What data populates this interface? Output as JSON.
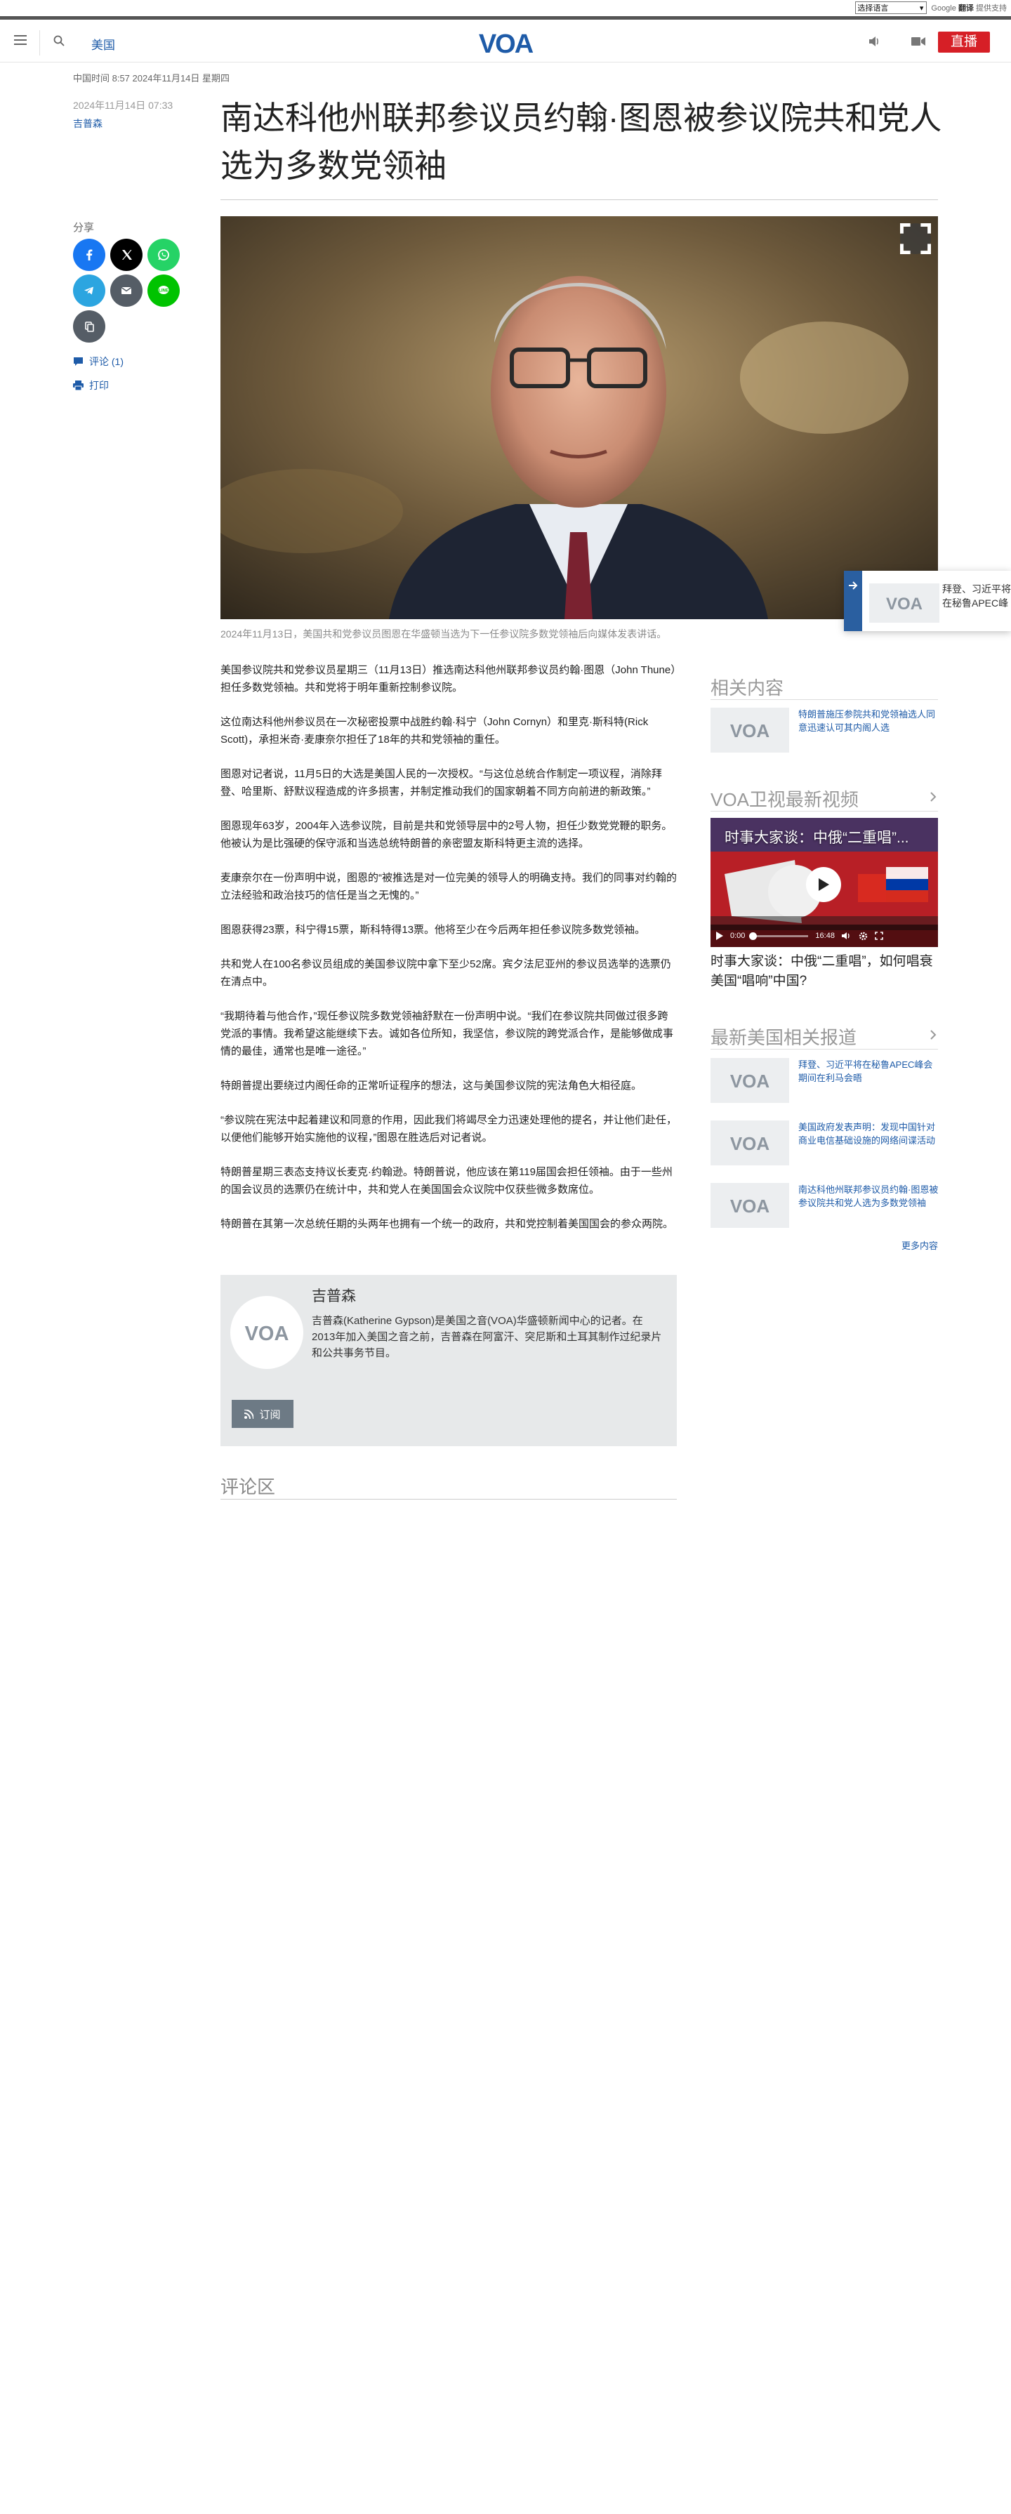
{
  "translate": {
    "select_label": "选择语言",
    "google": "Google",
    "translate": "翻译",
    "powered": "提供支持"
  },
  "header": {
    "section": "美国",
    "live": "直播",
    "logo_text": "VOA"
  },
  "meta": {
    "date_line": "中国时间 8:57 2024年11月14日 星期四",
    "pub_date": "2024年11月14日 07:33",
    "author": "吉普森"
  },
  "headline": "南达科他州联邦参议员约翰·图恩被参议院共和党人选为多数党领袖",
  "share": {
    "label": "分享",
    "comment": "评论 (1)",
    "print": "打印"
  },
  "colors": {
    "brand_blue": "#1e5ba8",
    "live_red": "#d61f26",
    "facebook": "#1877f2",
    "x": "#000000",
    "whatsapp": "#25d366",
    "telegram": "#2ca5e0",
    "email": "#555d66",
    "line": "#00c300",
    "copy": "#555d66"
  },
  "caption": "2024年11月13日，美国共和党参议员图恩在华盛顿当选为下一任参议院多数党领袖后向媒体发表讲话。",
  "floating_preview": {
    "title": "拜登、习近平将在秘鲁APEC峰会期间在利马会晤"
  },
  "body": [
    "美国参议院共和党参议员星期三（11月13日）推选南达科他州联邦参议员约翰·图恩（John Thune）担任多数党领袖。共和党将于明年重新控制参议院。",
    "这位南达科他州参议员在一次秘密投票中战胜约翰·科宁（John Cornyn）和里克·斯科特(Rick Scott)，承担米奇·麦康奈尔担任了18年的共和党领袖的重任。",
    "图恩对记者说，11月5日的大选是美国人民的一次授权。“与这位总统合作制定一项议程，消除拜登、哈里斯、舒默议程造成的许多损害，并制定推动我们的国家朝着不同方向前进的新政策。”",
    "图恩现年63岁，2004年入选参议院，目前是共和党领导层中的2号人物，担任少数党党鞭的职务。他被认为是比强硬的保守派和当选总统特朗普的亲密盟友斯科特更主流的选择。",
    "麦康奈尔在一份声明中说，图恩的“被推选是对一位完美的领导人的明确支持。我们的同事对约翰的立法经验和政治技巧的信任是当之无愧的。”",
    "图恩获得23票，科宁得15票，斯科特得13票。他将至少在今后两年担任参议院多数党领袖。",
    "共和党人在100名参议员组成的美国参议院中拿下至少52席。宾夕法尼亚州的参议员选举的选票仍在清点中。",
    "“我期待着与他合作，”现任参议院多数党领袖舒默在一份声明中说。“我们在参议院共同做过很多跨党派的事情。我希望这能继续下去。诚如各位所知，我坚信，参议院的跨党派合作，是能够做成事情的最佳，通常也是唯一途径。”",
    "特朗普提出要绕过内阁任命的正常听证程序的想法，这与美国参议院的宪法角色大相径庭。",
    "“参议院在宪法中起着建议和同意的作用，因此我们将竭尽全力迅速处理他的提名，并让他们赴任，以便他们能够开始实施他的议程，”图恩在胜选后对记者说。",
    "特朗普星期三表态支持议长麦克·约翰逊。特朗普说，他应该在第119届国会担任领袖。由于一些州的国会议员的选票仍在统计中，共和党人在美国国会众议院中仅获些微多数席位。",
    "特朗普在其第一次总统任期的头两年也拥有一个统一的政府，共和党控制着美国国会的参众两院。"
  ],
  "author_card": {
    "name": "吉普森",
    "bio": "吉普森(Katherine Gypson)是美国之音(VOA)华盛顿新闻中心的记者。在2013年加入美国之音之前，吉普森在阿富汗、突尼斯和土耳其制作过纪录片和公共事务节目。",
    "subscribe": "订阅"
  },
  "comments_title": "评论区",
  "sidebar": {
    "related_title": "相关内容",
    "related": [
      {
        "text": "特朗普施压参院共和党领袖选人同意迅速认可其内阁人选"
      }
    ],
    "video_title": "VOA卫视最新视频",
    "video": {
      "overlay": "时事大家谈：中俄“二重唱”...",
      "time_current": "0:00",
      "time_total": "16:48",
      "caption": "时事大家谈：中俄“二重唱”，如何唱衰美国“唱响”中国?"
    },
    "latest_title": "最新美国相关报道",
    "latest": [
      {
        "text": "拜登、习近平将在秘鲁APEC峰会期间在利马会晤"
      },
      {
        "text": "美国政府发表声明：发现中国针对商业电信基础设施的网络间谍活动"
      },
      {
        "text": "南达科他州联邦参议员约翰·图恩被参议院共和党人选为多数党领袖"
      }
    ],
    "more": "更多内容"
  }
}
